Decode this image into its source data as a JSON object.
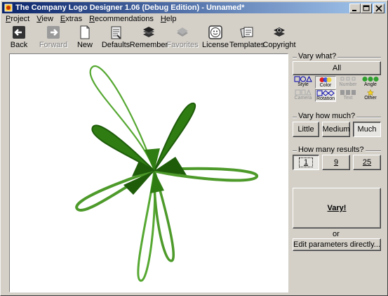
{
  "window": {
    "title": "The Company Logo Designer 1.06 (Debug Edition) - Unnamed*",
    "controls": [
      "_",
      "□",
      "×"
    ]
  },
  "menu": [
    {
      "label": "Project",
      "accel": "P",
      "rest": "roject"
    },
    {
      "label": "View",
      "accel": "V",
      "rest": "iew"
    },
    {
      "label": "Extras",
      "accel": "E",
      "rest": "xtras"
    },
    {
      "label": "Recommendations",
      "accel": "R",
      "rest": "ecommendations"
    },
    {
      "label": "Help",
      "accel": "H",
      "rest": "elp"
    }
  ],
  "toolbar": [
    {
      "label": "Back",
      "icon": "back-arrow-icon",
      "enabled": true
    },
    {
      "label": "Forward",
      "icon": "forward-arrow-icon",
      "enabled": false
    },
    {
      "label": "New",
      "icon": "new-page-icon",
      "enabled": true
    },
    {
      "label": "Defaults",
      "icon": "defaults-sheet-icon",
      "enabled": true
    },
    {
      "label": "Remember",
      "icon": "book-stack-icon",
      "enabled": true
    },
    {
      "label": "Favorites",
      "icon": "favorites-icon",
      "enabled": false
    },
    {
      "label": "License",
      "icon": "smiley-icon",
      "enabled": true
    },
    {
      "label": "Templates",
      "icon": "templates-icon",
      "enabled": true
    },
    {
      "label": "Copyright",
      "icon": "copyright-book-icon",
      "enabled": true
    }
  ],
  "vary_what": {
    "title": "Vary what?",
    "all_label": "All",
    "categories": [
      {
        "label": "Style",
        "icon": "shapes-icon",
        "enabled": true,
        "selected": false
      },
      {
        "label": "Color",
        "icon": "color-icon",
        "enabled": true,
        "selected": true
      },
      {
        "label": "Number",
        "icon": "number-icon",
        "enabled": false,
        "selected": false
      },
      {
        "label": "Angle",
        "icon": "angle-icon",
        "enabled": true,
        "selected": false
      },
      {
        "label": "Camera",
        "icon": "camera-icon",
        "enabled": false,
        "selected": false
      },
      {
        "label": "Rotation",
        "icon": "rotation-icon",
        "enabled": true,
        "selected": true
      },
      {
        "label": "Text",
        "icon": "text-icon",
        "enabled": false,
        "selected": false
      },
      {
        "label": "Other",
        "icon": "other-icon",
        "enabled": true,
        "selected": false
      }
    ]
  },
  "vary_how": {
    "title": "Vary how much?",
    "options": [
      {
        "label": "Little",
        "selected": false
      },
      {
        "label": "Medium",
        "selected": false
      },
      {
        "label": "Much",
        "selected": true
      }
    ]
  },
  "results": {
    "title": "How many results?",
    "options": [
      {
        "label": "1",
        "selected": true
      },
      {
        "label": "9",
        "selected": false
      },
      {
        "label": "25",
        "selected": false
      }
    ]
  },
  "actions": {
    "vary_label": "Vary!",
    "or_label": "or",
    "edit_label": "Edit parameters directly..."
  },
  "colors": {
    "title_start": "#0a246a",
    "title_end": "#a6caf0",
    "petal_dark": "#1e5c0a",
    "petal_mid": "#2f7d12",
    "petal_light": "#56a832"
  }
}
